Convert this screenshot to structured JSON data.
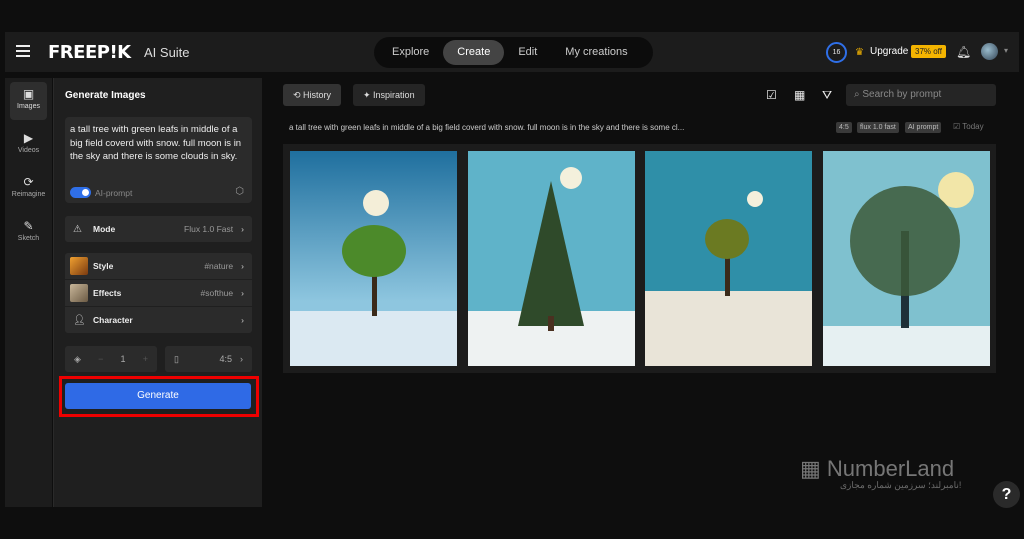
{
  "header": {
    "logo": "FREEP!K",
    "suite": "AI Suite",
    "nav": [
      "Explore",
      "Create",
      "Edit",
      "My creations"
    ],
    "active_nav": "Create",
    "credits": "16",
    "upgrade": "Upgrade",
    "discount": "37% off"
  },
  "rail": [
    {
      "label": "Images",
      "icon": "image-icon"
    },
    {
      "label": "Videos",
      "icon": "video-icon"
    },
    {
      "label": "Reimagine",
      "icon": "refresh-icon"
    },
    {
      "label": "Sketch",
      "icon": "brush-icon"
    }
  ],
  "panel": {
    "title": "Generate Images",
    "prompt": "a tall tree with green leafs in middle of a big field coverd with snow. full moon is in the sky and there is some clouds in sky.",
    "ai_prompt": "AI-prompt",
    "ai_prompt_on": true,
    "mode": {
      "label": "Mode",
      "value": "Flux 1.0 Fast"
    },
    "style": {
      "label": "Style",
      "value": "#nature"
    },
    "effects": {
      "label": "Effects",
      "value": "#softhue"
    },
    "character": {
      "label": "Character",
      "value": ""
    },
    "count": "1",
    "ratio": "4:5",
    "generate": "Generate"
  },
  "main": {
    "tabs": [
      "History",
      "Inspiration"
    ],
    "search_placeholder": "Search by prompt",
    "prompt_preview": "a tall tree with green leafs in middle of a big field coverd with snow. full moon is in the sky and there is some cl...",
    "chips": [
      "4:5",
      "flux 1.0 fast",
      "AI prompt"
    ],
    "date": "Today"
  },
  "watermark": {
    "name": "NumberLand",
    "tagline": "نامبرلند؛ سرزمین شماره مجازی!"
  },
  "colors": {
    "accent": "#2f6ae6",
    "upgrade": "#f4b400",
    "highlight": "#e00000"
  }
}
